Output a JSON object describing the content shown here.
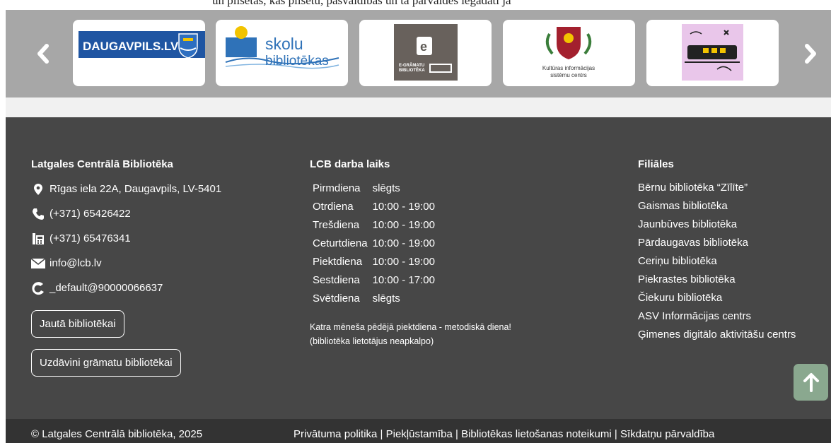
{
  "topline": "un pilsētas, kas pilsētu, pašvaldības un tā pārvaldes iegādāti jā",
  "carousel": {
    "prev_label": "Previous",
    "next_label": "Next",
    "logos": [
      {
        "name": "DAUGAVPILS.LV"
      },
      {
        "name": "skolu bibliotēkas",
        "line1": "skolu",
        "line2": "bibliotēkas"
      },
      {
        "name": "E-grāmatu bibliotēka",
        "caption1": "E-GRĀMATU",
        "caption2": "BIBLIOTĒKA"
      },
      {
        "name": "Kultūras informācijas sistēmu centrs",
        "caption1": "Kultūras informācijas",
        "caption2": "sistēmu centrs"
      },
      {
        "name": "Illustration"
      }
    ]
  },
  "footer": {
    "contact": {
      "title": "Latgales Centrālā Bibliotēka",
      "address": "Rīgas iela 22A, Daugavpils, LV-5401",
      "phone": "(+371) 65426422",
      "fax": "(+371) 65476341",
      "email": "info@lcb.lv",
      "eaddress": "_default@90000066637",
      "ask_button": "Jautā bibliotēkai",
      "donate_button": "Uzdāvini grāmatu bibliotēkai"
    },
    "hours": {
      "title": "LCB darba laiks",
      "rows": [
        {
          "day": "Pirmdiena",
          "time": "slēgts"
        },
        {
          "day": "Otrdiena",
          "time": "10:00 - 19:00"
        },
        {
          "day": "Trešdiena",
          "time": "10:00 - 19:00"
        },
        {
          "day": "Ceturtdiena",
          "time": "10:00 - 19:00"
        },
        {
          "day": "Piektdiena",
          "time": "10:00 - 19:00"
        },
        {
          "day": "Sestdiena",
          "time": "10:00 - 17:00"
        },
        {
          "day": "Svētdiena",
          "time": "slēgts"
        }
      ],
      "note1": "Katra mēneša pēdējā piektdiena - metodiskā diena!",
      "note2": "(bibliotēka lietotājus neapkalpo)"
    },
    "branches": {
      "title": "Filiāles",
      "items": [
        "Bērnu bibliotēka “Zīlīte”",
        "Gaismas bibliotēka",
        "Jaunbūves bibliotēka",
        "Pārdaugavas bibliotēka",
        "Ceriņu bibliotēka",
        "Piekrastes bibliotēka",
        "Čiekuru bibliotēka",
        "ASV Informācijas centrs",
        "Ģimenes digitālo aktivitāšu centrs"
      ]
    }
  },
  "bottom": {
    "copyright": "© Latgales Centrālā bibliotēka, 2025",
    "links": [
      "Privātuma politika",
      "Piekļūstamība",
      "Bibliotēkas lietošanas noteikumi",
      "Sīkdatņu pārvaldība"
    ],
    "separator": " | "
  },
  "colors": {
    "footer_bg": "#474747",
    "bottombar_bg": "#333333",
    "carousel_bg": "#a7a7a7",
    "to_top_bg": "#8aa88f"
  }
}
